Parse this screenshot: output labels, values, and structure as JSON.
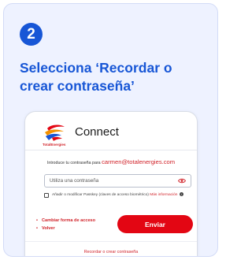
{
  "step": {
    "number": "2"
  },
  "headline": "Selecciona ‘Recordar o crear contraseña’",
  "login": {
    "brand_text": "TotalEnergies",
    "title": "Connect",
    "intro_prefix": "Introduce tu contraseña para",
    "email": "carmen@totalenergies.com",
    "password_placeholder": "Utiliza una contraseña",
    "passkey_label": "Añadir o modificar Passkey (claves de acceso biométrico)",
    "more_info": "Más información",
    "change_method": "Cambiar forma de acceso",
    "back": "Volver",
    "send_button": "Enviar",
    "recover_link": "Recordar o crear contraseña"
  },
  "colors": {
    "accent": "#1756d6",
    "brand_red": "#e30613",
    "card_bg": "#eef2ff"
  },
  "icons": [
    "totalenergies-logo",
    "eye-icon",
    "info-icon",
    "checkbox"
  ]
}
